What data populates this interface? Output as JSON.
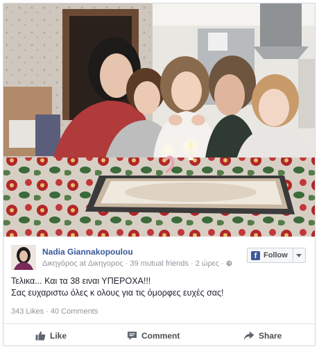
{
  "post": {
    "author": "Nadia Giannakopoulou",
    "subtitle_role": "Δικηγόρος at Δικηγορος",
    "mutual_friends": "39 mutual friends",
    "time": "2 ώρες",
    "text_line1": "Τελικα... Και τα 38 ειναι ΥΠΕΡΟΧΑ!!!",
    "text_line2": "Σας ευχαριστω όλες κ ολους για τις όμορφες ευχές σας!",
    "likes": "343 Likes",
    "comments_count": "40 Comments"
  },
  "follow": {
    "label": "Follow",
    "logo": "f"
  },
  "actions": {
    "like": "Like",
    "comment": "Comment",
    "share": "Share"
  },
  "icons": [
    "facebook-logo-icon",
    "globe-icon",
    "chevron-down-icon",
    "thumbs-up-icon",
    "comment-icon",
    "share-icon"
  ],
  "colors": {
    "author_link": "#365899",
    "meta": "#90949c",
    "facebook_blue": "#3b5998",
    "border": "#d3d6db"
  }
}
